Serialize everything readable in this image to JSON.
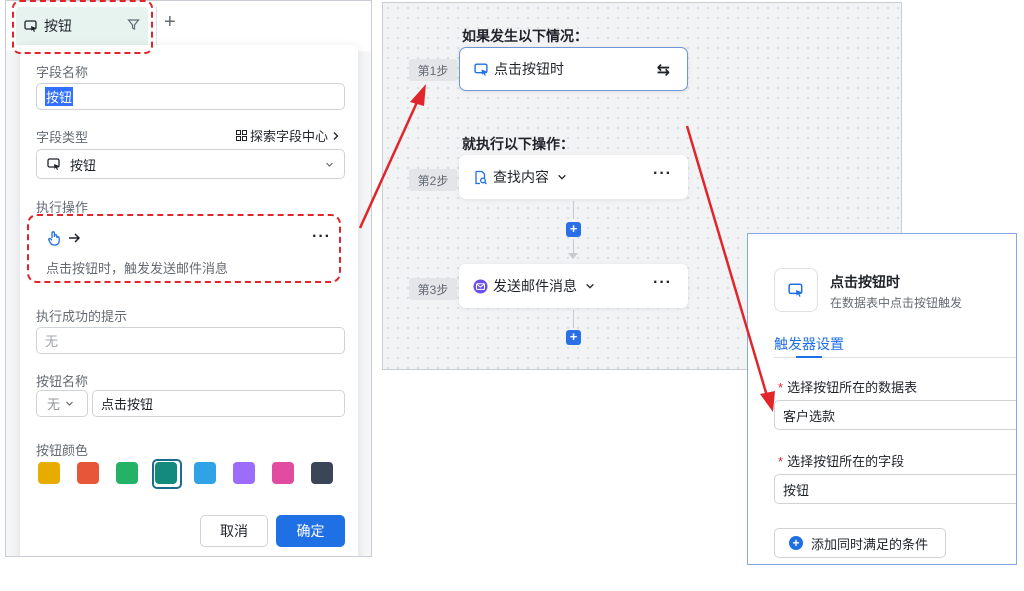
{
  "colors": {
    "accent": "#1f6fe5",
    "annotation_red": "#e0262b",
    "swatches": [
      "#e6ad00",
      "#e8563a",
      "#24b266",
      "#128a7c",
      "#2fa3e6",
      "#9c6dfa",
      "#e14ca0",
      "#3b4558"
    ]
  },
  "left_panel": {
    "tab": {
      "label": "按钮",
      "icon": "button-cursor-icon",
      "filter_icon": "filter-icon"
    },
    "add_tab_label": "+",
    "field_name": {
      "label": "字段名称",
      "value": "按钮"
    },
    "field_type": {
      "label": "字段类型",
      "value": "按钮",
      "explore_label": "探索字段中心"
    },
    "action": {
      "label": "执行操作",
      "description": "点击按钮时，触发发送邮件消息",
      "more": "···"
    },
    "success_tip": {
      "label": "执行成功的提示",
      "placeholder": "无"
    },
    "button_name": {
      "label": "按钮名称",
      "prefix_value": "无",
      "value": "点击按钮"
    },
    "button_color": {
      "label": "按钮颜色",
      "selected_index": 3
    },
    "cancel_label": "取消",
    "confirm_label": "确定"
  },
  "workflow": {
    "trigger_heading": "如果发生以下情况：",
    "action_heading": "就执行以下操作：",
    "steps": [
      {
        "step": "第1步",
        "label": "点击按钮时",
        "icon": "button-cursor-icon",
        "right": "⇆"
      },
      {
        "step": "第2步",
        "label": "查找内容",
        "icon": "search-doc-icon",
        "right": "···"
      },
      {
        "step": "第3步",
        "label": "发送邮件消息",
        "icon": "mail-icon",
        "right": "···"
      }
    ],
    "add_label": "+"
  },
  "trigger_panel": {
    "title": "点击按钮时",
    "subtitle": "在数据表中点击按钮触发",
    "tab_label": "触发器设置",
    "table_label": "选择按钮所在的数据表",
    "table_value": "客户选款",
    "field_label": "选择按钮所在的字段",
    "field_value": "按钮",
    "required_mark": "*",
    "add_condition_label": "添加同时满足的条件"
  }
}
